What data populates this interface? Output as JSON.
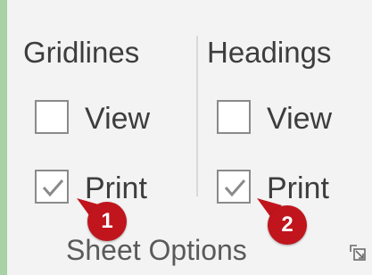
{
  "group": {
    "title": "Sheet Options"
  },
  "gridlines": {
    "header": "Gridlines",
    "view": {
      "label": "View",
      "checked": false
    },
    "print": {
      "label": "Print",
      "checked": true
    }
  },
  "headings": {
    "header": "Headings",
    "view": {
      "label": "View",
      "checked": false
    },
    "print": {
      "label": "Print",
      "checked": true
    }
  },
  "callouts": [
    {
      "label": "1",
      "color": "#c0151d"
    },
    {
      "label": "2",
      "color": "#c0151d"
    }
  ],
  "icons": {
    "launcher": "dialog-launcher-icon",
    "checkmark": "checkmark-icon"
  },
  "colors": {
    "group_border": "#a9d1a6",
    "background": "#f3f3f3",
    "callout": "#c0151d"
  }
}
